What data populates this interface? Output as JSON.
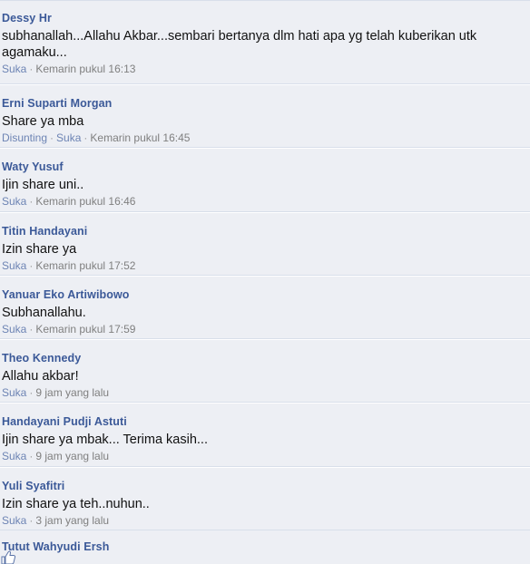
{
  "comments": [
    {
      "author": "Dessy Hr",
      "text": "subhanallah...Allahu Akbar...sembari bertanya dlm hati apa yg telah kuberikan utk agamaku...",
      "actions": [
        "Suka"
      ],
      "time": "Kemarin pukul 16:13"
    },
    {
      "author": "Erni Suparti Morgan",
      "text": "Share ya mba",
      "actions": [
        "Disunting",
        "Suka"
      ],
      "time": "Kemarin pukul 16:45"
    },
    {
      "author": "Waty Yusuf",
      "text": "Ijin share uni..",
      "actions": [
        "Suka"
      ],
      "time": "Kemarin pukul 16:46"
    },
    {
      "author": "Titin Handayani",
      "text": "Izin share ya",
      "actions": [
        "Suka"
      ],
      "time": "Kemarin pukul 17:52"
    },
    {
      "author": "Yanuar Eko Artiwibowo",
      "text": "Subhanallahu.",
      "actions": [
        "Suka"
      ],
      "time": "Kemarin pukul 17:59"
    },
    {
      "author": "Theo Kennedy",
      "text": "Allahu akbar!",
      "actions": [
        "Suka"
      ],
      "time": "9 jam yang lalu"
    },
    {
      "author": "Handayani Pudji Astuti",
      "text": "Ijin share ya mbak... Terima kasih...",
      "actions": [
        "Suka"
      ],
      "time": "9 jam yang lalu"
    },
    {
      "author": "Yuli Syafitri",
      "text": "Izin share ya teh..nuhun..",
      "actions": [
        "Suka"
      ],
      "time": "3 jam yang lalu"
    }
  ],
  "last_comment": {
    "author": "Tutut Wahyudi Ersh",
    "icon": "thumbs-up-icon"
  },
  "colors": {
    "background": "#edeff4",
    "author": "#3b5998",
    "link": "#6d84b4",
    "meta": "#7f7f7f",
    "divider": "#d8dfea"
  }
}
